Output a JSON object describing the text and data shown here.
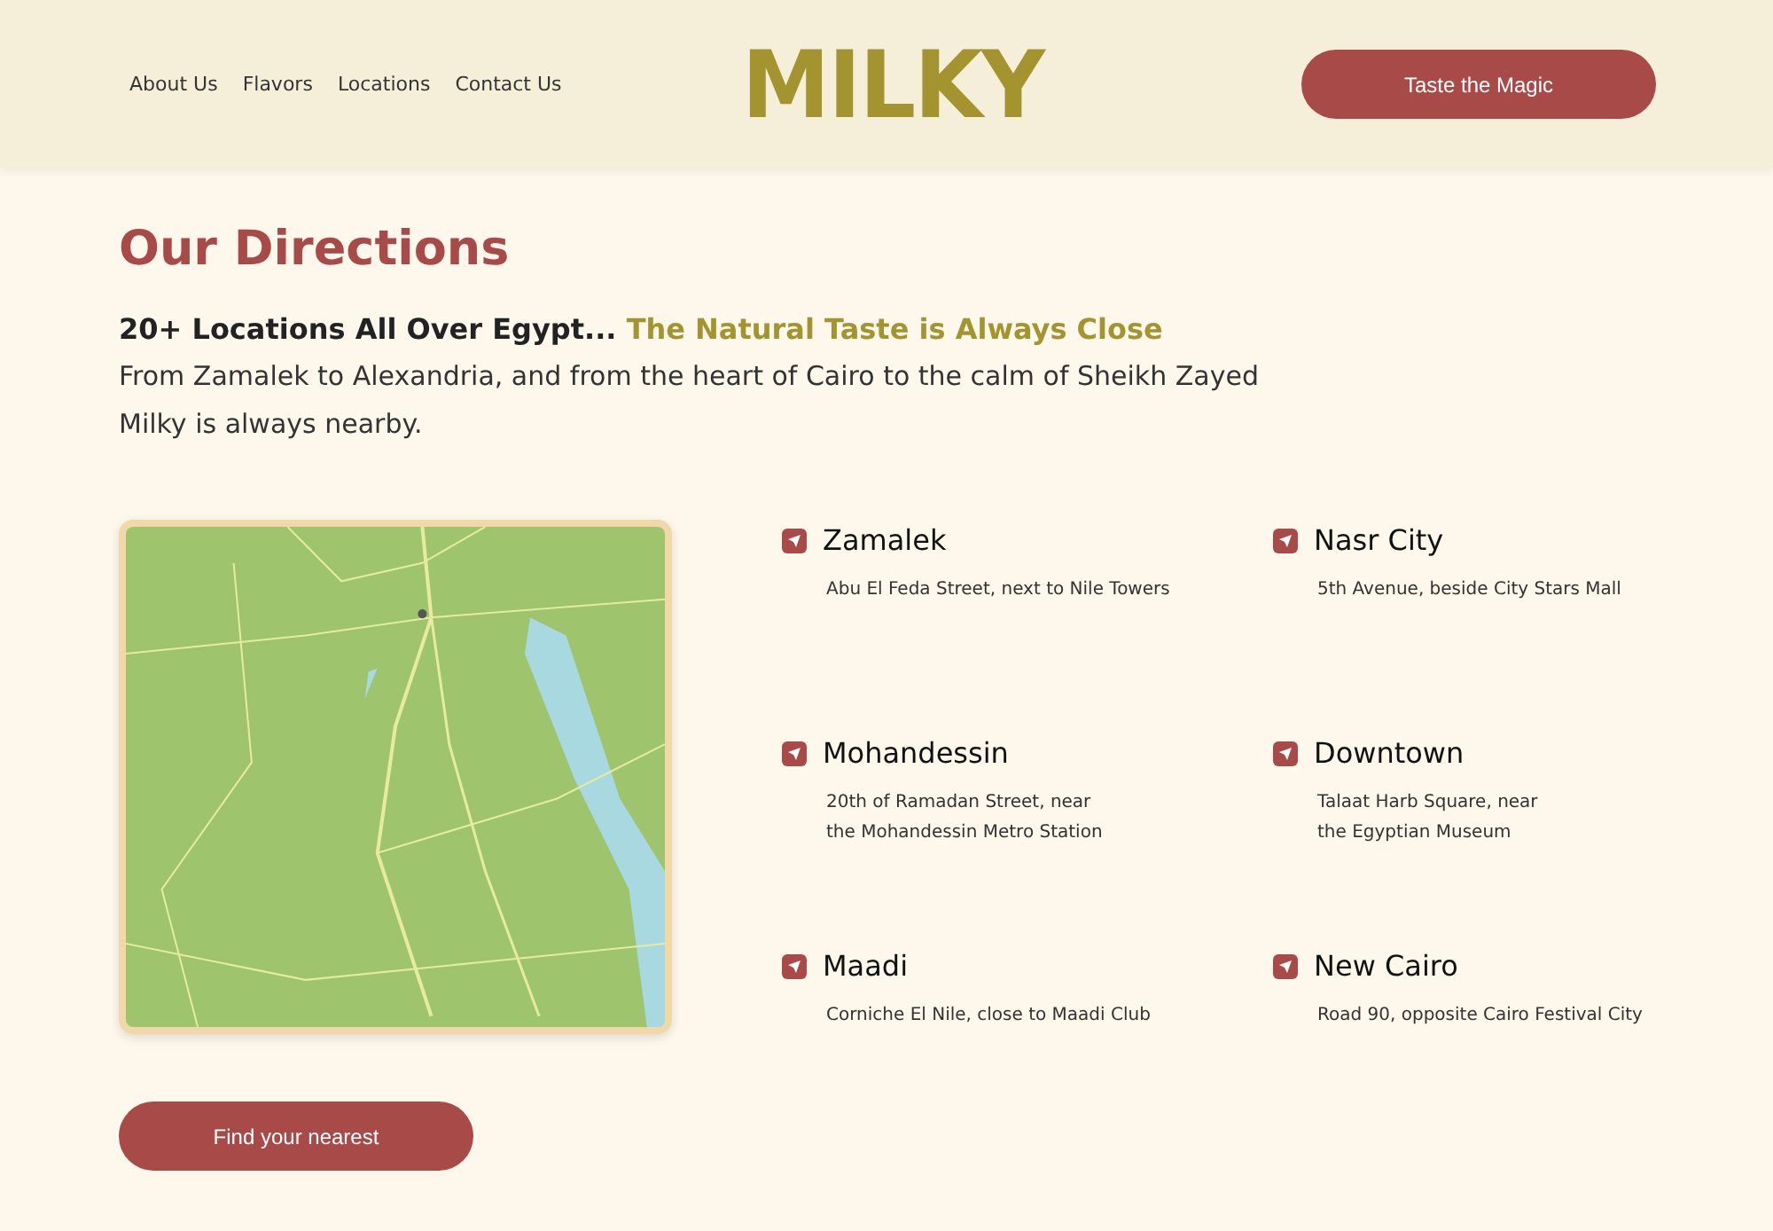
{
  "header": {
    "nav": [
      "About Us",
      "Flavors",
      "Locations",
      "Contact Us"
    ],
    "logo": "MILKY",
    "cta": "Taste the Magic"
  },
  "section": {
    "title": "Our Directions",
    "lead": "20+ Locations All Over Egypt...",
    "lead_highlight": "The Natural Taste is Always Close",
    "body": [
      "From Zamalek to Alexandria, and from the heart of Cairo to the calm of Sheikh Zayed",
      "Milky is always nearby."
    ]
  },
  "locations": [
    {
      "name": "Zamalek",
      "address": [
        "Abu El Feda Street, next to Nile Towers"
      ]
    },
    {
      "name": "Nasr City",
      "address": [
        "5th Avenue, beside City Stars Mall"
      ]
    },
    {
      "name": "Mohandessin",
      "address": [
        "20th of Ramadan Street, near",
        "the Mohandessin Metro Station"
      ]
    },
    {
      "name": "Downtown",
      "address": [
        "Talaat Harb Square, near",
        "the Egyptian Museum"
      ]
    },
    {
      "name": "Maadi",
      "address": [
        "Corniche El Nile, close to Maadi Club"
      ]
    },
    {
      "name": "New Cairo",
      "address": [
        "Road 90, opposite Cairo Festival City"
      ]
    }
  ],
  "button": "Find your nearest"
}
